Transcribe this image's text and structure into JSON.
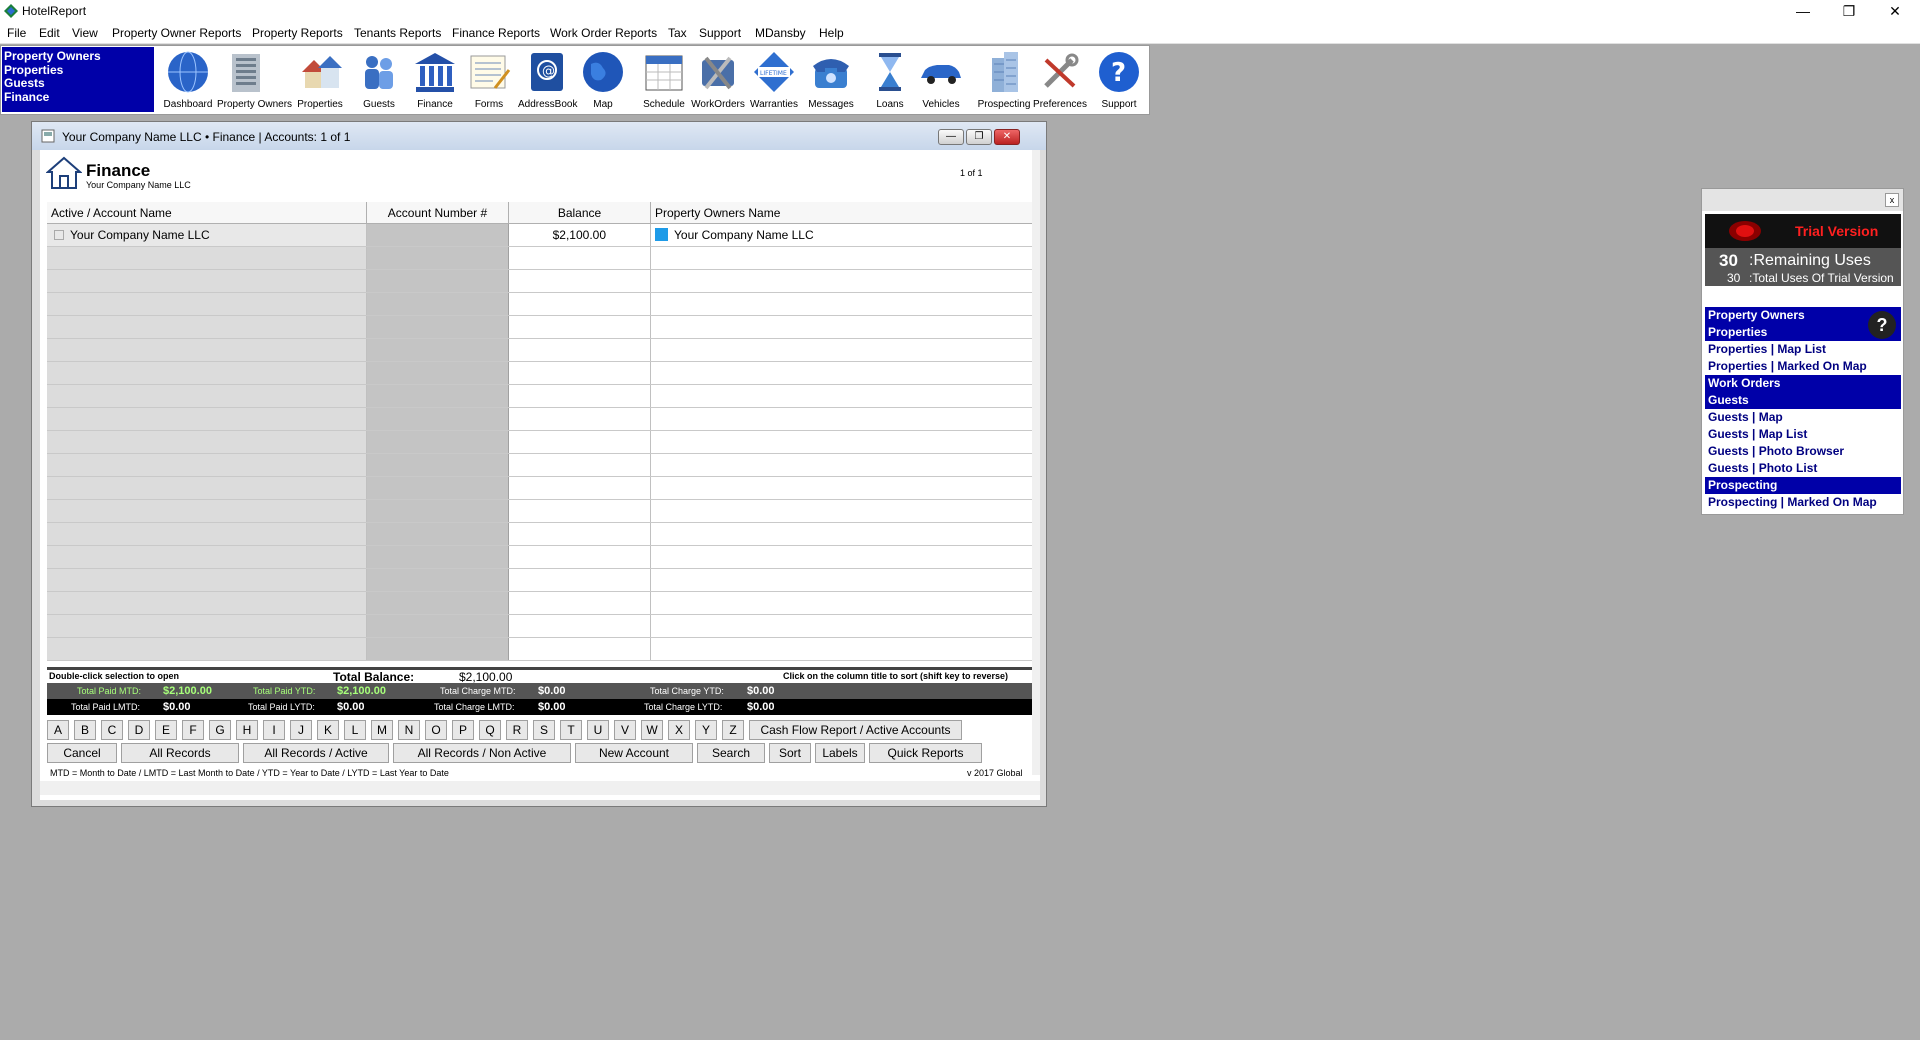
{
  "app": {
    "title": "HotelReport"
  },
  "window_controls": {
    "minimize": "—",
    "restore": "❐",
    "close": "✕"
  },
  "menu": [
    "File",
    "Edit",
    "View",
    "Property Owner Reports",
    "Property Reports",
    "Tenants Reports",
    "Finance Reports",
    "Work Order Reports",
    "Tax",
    "Support",
    "MDansby",
    "Help"
  ],
  "nav_box": [
    "Property Owners",
    "Properties",
    "Guests",
    "Finance"
  ],
  "toolbar": [
    {
      "label": "Dashboard",
      "icon": "globe-icon"
    },
    {
      "label": "Property Owners",
      "icon": "building-icon"
    },
    {
      "label": "Properties",
      "icon": "houses-icon"
    },
    {
      "label": "Guests",
      "icon": "guests-icon"
    },
    {
      "label": "Finance",
      "icon": "bank-icon"
    },
    {
      "label": "Forms",
      "icon": "forms-icon"
    },
    {
      "label": "AddressBook",
      "icon": "address-book-icon"
    },
    {
      "label": "Map",
      "icon": "globe-map-icon"
    },
    {
      "label": "Schedule",
      "icon": "calendar-icon"
    },
    {
      "label": "WorkOrders",
      "icon": "tools-icon"
    },
    {
      "label": "Warranties",
      "icon": "warranty-badge-icon"
    },
    {
      "label": "Messages",
      "icon": "telephone-icon"
    },
    {
      "label": "Loans",
      "icon": "hourglass-icon"
    },
    {
      "label": "Vehicles",
      "icon": "car-icon"
    },
    {
      "label": "Prospecting",
      "icon": "skyscraper-icon"
    },
    {
      "label": "Preferences",
      "icon": "wrench-screwdriver-icon"
    },
    {
      "label": "Support",
      "icon": "help-icon"
    }
  ],
  "finance": {
    "window_title": "Your Company Name LLC  •  Finance | Accounts: 1 of 1",
    "title": "Finance",
    "subtitle": "Your Company Name LLC",
    "page": "1  of  1",
    "columns": [
      "Active / Account Name",
      "Account Number #",
      "Balance",
      "Property Owners Name"
    ],
    "rows": [
      {
        "account_name": "Your Company Name LLC",
        "account_number": "",
        "balance": "$2,100.00",
        "owner": "Your Company Name LLC"
      }
    ],
    "hint_open": "Double-click selection to open",
    "total_balance_label": "Total Balance:",
    "total_balance": "$2,100.00",
    "hint_sort": "Click on the column title to sort (shift key to reverse)",
    "totals": {
      "paid_mtd_label": "Total Paid MTD:",
      "paid_mtd": "$2,100.00",
      "paid_ytd_label": "Total Paid YTD:",
      "paid_ytd": "$2,100.00",
      "charge_mtd_label": "Total Charge MTD:",
      "charge_mtd": "$0.00",
      "charge_ytd_label": "Total Charge YTD:",
      "charge_ytd": "$0.00",
      "paid_lmtd_label": "Total Paid LMTD:",
      "paid_lmtd": "$0.00",
      "paid_lytd_label": "Total Paid LYTD:",
      "paid_lytd": "$0.00",
      "charge_lmtd_label": "Total Charge LMTD:",
      "charge_lmtd": "$0.00",
      "charge_lytd_label": "Total Charge LYTD:",
      "charge_lytd": "$0.00"
    },
    "alpha": [
      "A",
      "B",
      "C",
      "D",
      "E",
      "F",
      "G",
      "H",
      "I",
      "J",
      "K",
      "L",
      "M",
      "N",
      "O",
      "P",
      "Q",
      "R",
      "S",
      "T",
      "U",
      "V",
      "W",
      "X",
      "Y",
      "Z"
    ],
    "cashflow_button": "Cash Flow Report / Active Accounts",
    "buttons": {
      "cancel": "Cancel",
      "all_records": "All Records",
      "all_active": "All Records / Active",
      "all_non_active": "All Records / Non Active",
      "new_account": "New Account",
      "search": "Search",
      "sort": "Sort",
      "labels": "Labels",
      "quick_reports": "Quick Reports"
    },
    "legend": "MTD = Month to Date  /  LMTD = Last Month to Date  /  YTD = Year to Date  /  LYTD = Last Year to Date",
    "version": "v 2017 Global"
  },
  "trial": {
    "title": "Trial Version",
    "remaining_n": "30",
    "remaining_label": ":Remaining Uses",
    "total_n": "30",
    "total_label": ":Total Uses Of Trial Version"
  },
  "side_panel": {
    "close": "x",
    "help": "?",
    "items": [
      {
        "label": "Property Owners",
        "type": "head"
      },
      {
        "label": "Properties",
        "type": "head"
      },
      {
        "label": "Properties | Map List",
        "type": "link"
      },
      {
        "label": "Properties | Marked On Map",
        "type": "link"
      },
      {
        "label": "Work Orders",
        "type": "head"
      },
      {
        "label": "Guests",
        "type": "head"
      },
      {
        "label": "Guests | Map",
        "type": "link"
      },
      {
        "label": "Guests | Map List",
        "type": "link"
      },
      {
        "label": "Guests | Photo Browser",
        "type": "link"
      },
      {
        "label": "Guests | Photo List",
        "type": "link"
      },
      {
        "label": "Prospecting",
        "type": "head"
      },
      {
        "label": "Prospecting | Marked On Map",
        "type": "link"
      }
    ]
  }
}
